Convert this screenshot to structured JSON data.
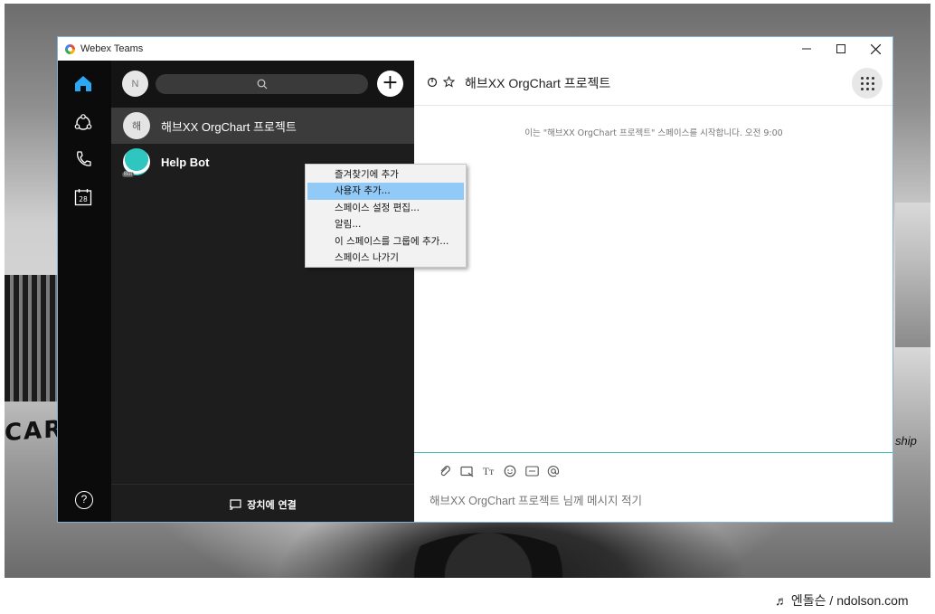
{
  "window": {
    "title": "Webex Teams"
  },
  "rail": {
    "calendar_day": "28",
    "help_label": "?"
  },
  "spaces_panel": {
    "user_avatar_initial": "N",
    "add_label": "+",
    "items": [
      {
        "avatar": "해",
        "name": "해브XX OrgChart 프로젝트"
      },
      {
        "avatar": "",
        "name": "Help Bot",
        "badge": "Bot"
      }
    ],
    "footer_label": "장치에 연결"
  },
  "context_menu": {
    "items": [
      "즐겨찾기에 추가",
      "사용자 추가...",
      "스페이스 설정 편집...",
      "알림...",
      "이 스페이스를 그룹에 추가...",
      "스페이스 나가기"
    ],
    "highlighted_index": 1
  },
  "conversation": {
    "title": "해브XX OrgChart 프로젝트",
    "notice": "이는 \"해브XX OrgChart 프로젝트\" 스페이스를 시작합니다. 오전 9:00",
    "composer_placeholder": "해브XX OrgChart 프로젝트 님께 메시지 적기",
    "tools": [
      "attach-icon",
      "share-screen-icon",
      "format-text-icon",
      "emoji-icon",
      "gif-icon",
      "mention-icon"
    ]
  },
  "wallpaper": {
    "car_text": "CAR",
    "car_text_right": "ship"
  },
  "watermark": "♬ 엔돌슨 / ndolson.com",
  "colors": {
    "accent": "#42b5b0",
    "menu_highlight": "#91c9f7",
    "rail_bg": "#0b0b0b",
    "panel_bg": "#1d1d1d"
  }
}
